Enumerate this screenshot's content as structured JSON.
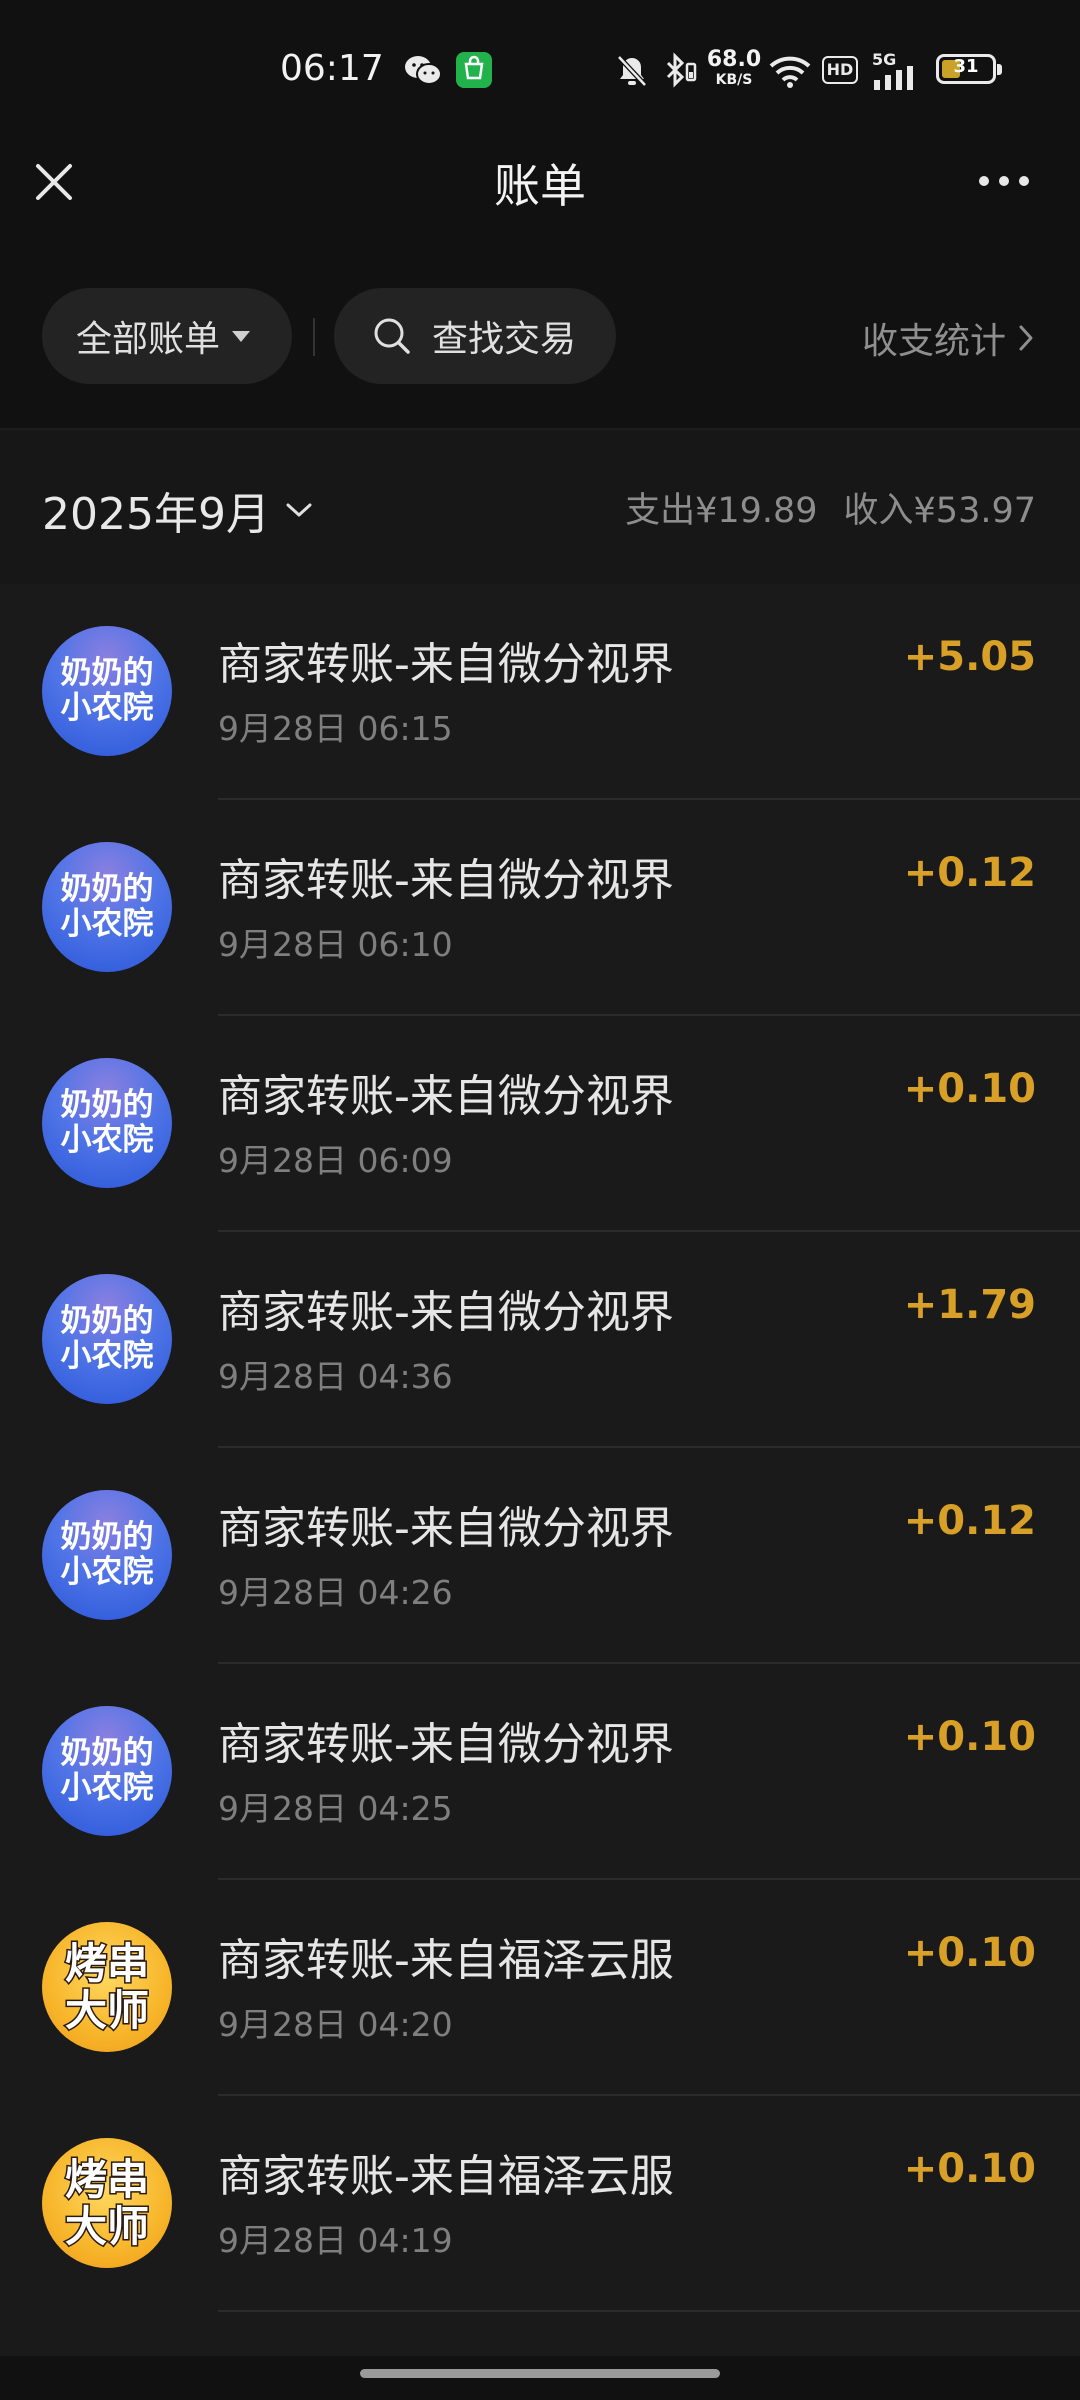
{
  "status_bar": {
    "time": "06:17",
    "net_speed_value": "68.0",
    "net_speed_unit": "KB/S",
    "hd_label": "HD",
    "network_label": "5G",
    "battery": "31"
  },
  "header": {
    "title": "账单",
    "close_icon": "close-icon",
    "more_icon": "more-icon"
  },
  "filters": {
    "all_bills_label": "全部账单",
    "search_label": "查找交易",
    "stats_label": "收支统计"
  },
  "month_bar": {
    "month": "2025年9月",
    "expense": "支出¥19.89",
    "income": "收入¥53.97"
  },
  "colors": {
    "amount": "#d9a028",
    "background": "#111111",
    "list_background": "#1a1a1a"
  },
  "transactions": [
    {
      "avatar_lines": [
        "奶奶的",
        "小农院"
      ],
      "avatar_style": "blue",
      "title": "商家转账-来自微分视界",
      "time": "9月28日 06:15",
      "amount": "+5.05"
    },
    {
      "avatar_lines": [
        "奶奶的",
        "小农院"
      ],
      "avatar_style": "blue",
      "title": "商家转账-来自微分视界",
      "time": "9月28日 06:10",
      "amount": "+0.12"
    },
    {
      "avatar_lines": [
        "奶奶的",
        "小农院"
      ],
      "avatar_style": "blue",
      "title": "商家转账-来自微分视界",
      "time": "9月28日 06:09",
      "amount": "+0.10"
    },
    {
      "avatar_lines": [
        "奶奶的",
        "小农院"
      ],
      "avatar_style": "blue",
      "title": "商家转账-来自微分视界",
      "time": "9月28日 04:36",
      "amount": "+1.79"
    },
    {
      "avatar_lines": [
        "奶奶的",
        "小农院"
      ],
      "avatar_style": "blue",
      "title": "商家转账-来自微分视界",
      "time": "9月28日 04:26",
      "amount": "+0.12"
    },
    {
      "avatar_lines": [
        "奶奶的",
        "小农院"
      ],
      "avatar_style": "blue",
      "title": "商家转账-来自微分视界",
      "time": "9月28日 04:25",
      "amount": "+0.10"
    },
    {
      "avatar_lines": [
        "烤串",
        "大师"
      ],
      "avatar_style": "orange",
      "title": "商家转账-来自福泽云服",
      "time": "9月28日 04:20",
      "amount": "+0.10"
    },
    {
      "avatar_lines": [
        "烤串",
        "大师"
      ],
      "avatar_style": "orange",
      "title": "商家转账-来自福泽云服",
      "time": "9月28日 04:19",
      "amount": "+0.10"
    }
  ]
}
